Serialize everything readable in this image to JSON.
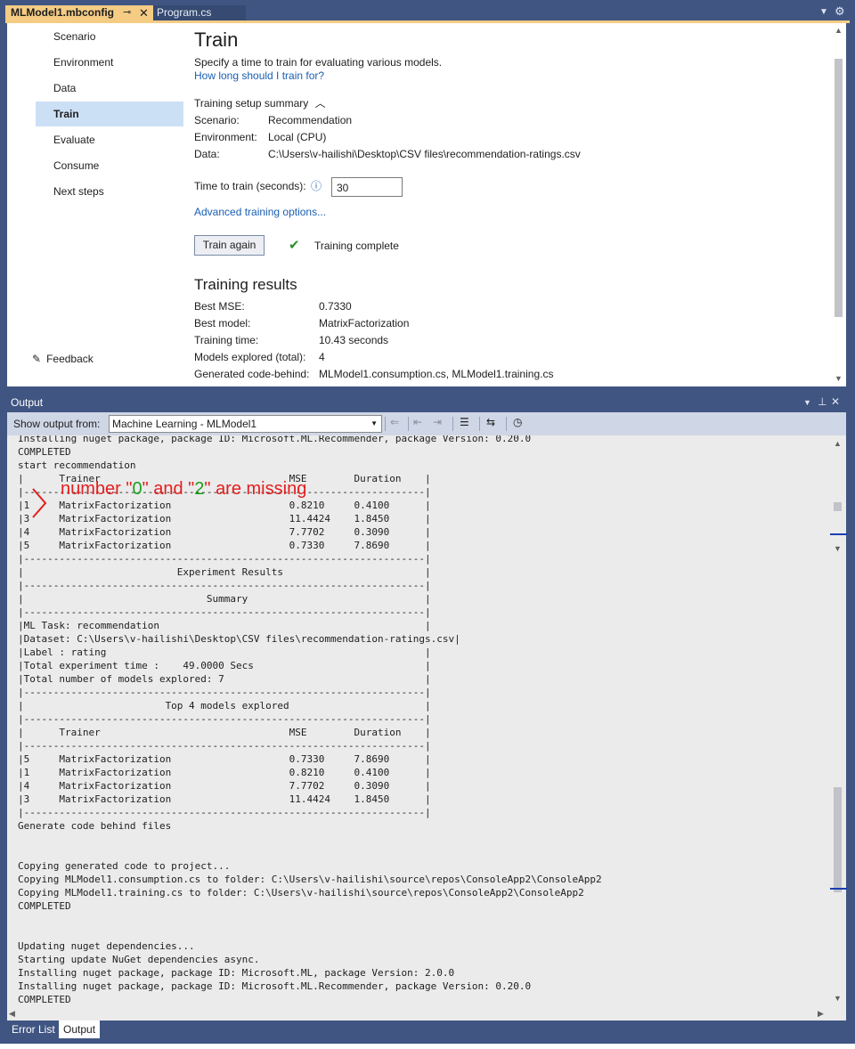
{
  "tabs": {
    "active_file": "MLModel1.mbconfig",
    "pin_glyph": "⊸",
    "close_glyph": "✕",
    "other_file": "Program.cs"
  },
  "nav": {
    "items": [
      {
        "label": "Scenario"
      },
      {
        "label": "Environment"
      },
      {
        "label": "Data"
      },
      {
        "label": "Train"
      },
      {
        "label": "Evaluate"
      },
      {
        "label": "Consume"
      },
      {
        "label": "Next steps"
      }
    ],
    "selected": "Train",
    "feedback": "Feedback"
  },
  "train": {
    "title": "Train",
    "description": "Specify a time to train for evaluating various models.",
    "how_long_link": "How long should I train for?",
    "summary_toggle": "Training setup summary",
    "summary": [
      {
        "label": "Scenario:",
        "value": "Recommendation"
      },
      {
        "label": "Environment:",
        "value": "Local (CPU)"
      },
      {
        "label": "Data:",
        "value": "C:\\Users\\v-hailishi\\Desktop\\CSV files\\recommendation-ratings.csv"
      }
    ],
    "time_label": "Time to train (seconds):",
    "time_value": "30",
    "advanced_link": "Advanced training options...",
    "train_button": "Train again",
    "status": "Training complete"
  },
  "results": {
    "title": "Training results",
    "rows": [
      {
        "label": "Best MSE:",
        "value": "0.7330"
      },
      {
        "label": "Best model:",
        "value": "MatrixFactorization"
      },
      {
        "label": "Training time:",
        "value": "10.43 seconds"
      },
      {
        "label": "Models explored (total):",
        "value": "4"
      },
      {
        "label": "Generated code-behind:",
        "value": "MLModel1.consumption.cs, MLModel1.training.cs"
      }
    ]
  },
  "output": {
    "title": "Output",
    "show_from_label": "Show output from:",
    "source": "Machine Learning - MLModel1",
    "log": "Installing nuget package, package ID: Microsoft.ML.Recommender, package Version: 0.20.0\nCOMPLETED\nstart recommendation\n|      Trainer                                MSE        Duration    |\n|--------------------------------------------------------------------|\n|1     MatrixFactorization                    0.8210     0.4100      |\n|3     MatrixFactorization                    11.4424    1.8450      |\n|4     MatrixFactorization                    7.7702     0.3090      |\n|5     MatrixFactorization                    0.7330     7.8690      |\n|--------------------------------------------------------------------|\n|                          Experiment Results                        |\n|--------------------------------------------------------------------|\n|                               Summary                              |\n|--------------------------------------------------------------------|\n|ML Task: recommendation                                             |\n|Dataset: C:\\Users\\v-hailishi\\Desktop\\CSV files\\recommendation-ratings.csv|\n|Label : rating                                                      |\n|Total experiment time :    49.0000 Secs                             |\n|Total number of models explored: 7                                  |\n|--------------------------------------------------------------------|\n|                        Top 4 models explored                       |\n|--------------------------------------------------------------------|\n|      Trainer                                MSE        Duration    |\n|--------------------------------------------------------------------|\n|5     MatrixFactorization                    0.7330     7.8690      |\n|1     MatrixFactorization                    0.8210     0.4100      |\n|4     MatrixFactorization                    7.7702     0.3090      |\n|3     MatrixFactorization                    11.4424    1.8450      |\n|--------------------------------------------------------------------|\nGenerate code behind files\n\n\nCopying generated code to project...\nCopying MLModel1.consumption.cs to folder: C:\\Users\\v-hailishi\\source\\repos\\ConsoleApp2\\ConsoleApp2\nCopying MLModel1.training.cs to folder: C:\\Users\\v-hailishi\\source\\repos\\ConsoleApp2\\ConsoleApp2\nCOMPLETED\n\n\nUpdating nuget dependencies...\nStarting update NuGet dependencies async.\nInstalling nuget package, package ID: Microsoft.ML, package Version: 2.0.0\nInstalling nuget package, package ID: Microsoft.ML.Recommender, package Version: 0.20.0\nCOMPLETED",
    "annotation": {
      "part1": "number \"",
      "n0": "0",
      "part2": "\" and \"",
      "n2": "2",
      "part3": "\" are missing"
    }
  },
  "bottom_tabs": {
    "error_list": "Error List",
    "output": "Output"
  },
  "colors": {
    "chrome": "#405582",
    "active_tab": "#f5cc84",
    "selected_nav": "#cce0f5",
    "link": "#1a5fb4",
    "annotation_red": "#e41e1e",
    "annotation_green": "#1aa01a"
  }
}
